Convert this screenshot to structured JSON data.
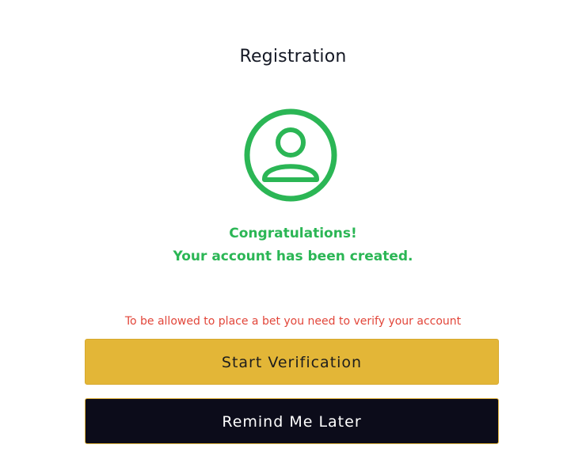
{
  "header": {
    "title": "Registration"
  },
  "status": {
    "icon": "user-check-icon",
    "line1": "Congratulations!",
    "line2": "Your account has been created.",
    "color": "#2bb655"
  },
  "verification": {
    "notice": "To be allowed to place a bet you need to verify your account",
    "notice_color": "#e2463a",
    "start_label": "Start Verification",
    "start_color": "#e3b637",
    "later_label": "Remind Me Later",
    "later_color": "#0c0c1a"
  }
}
